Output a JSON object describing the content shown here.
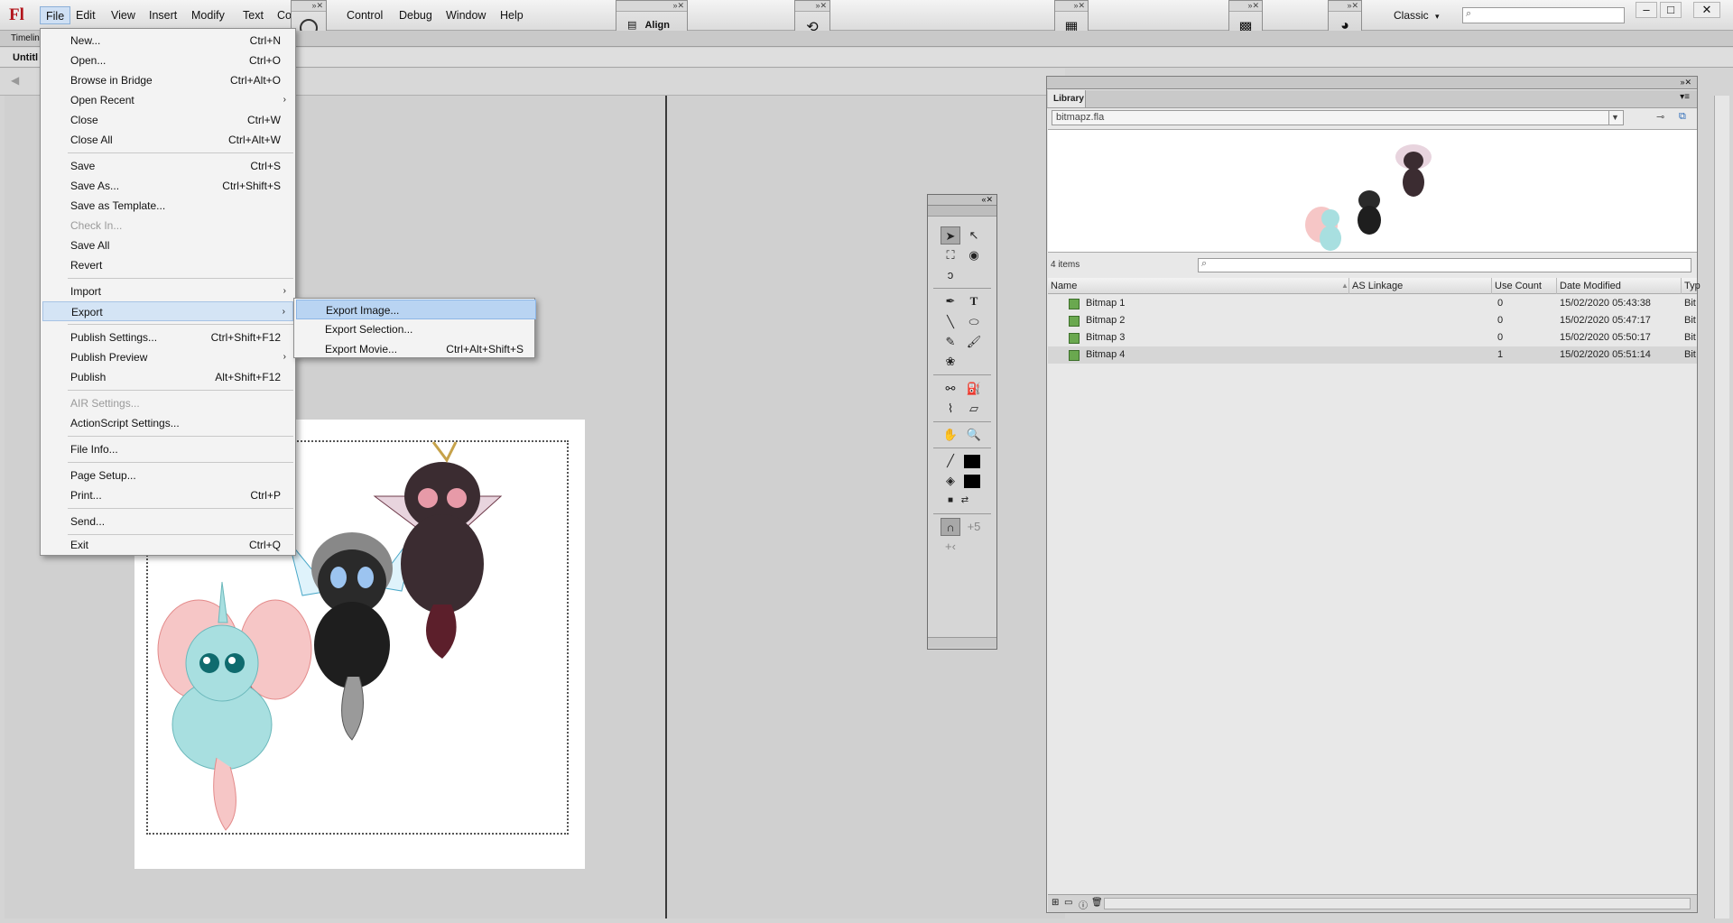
{
  "app": {
    "logo": "Fl",
    "menus": [
      "File",
      "Edit",
      "View",
      "Insert",
      "Modify",
      "Text",
      "Co",
      "Control",
      "Debug",
      "Window",
      "Help"
    ],
    "workspace": "Classic",
    "workspace_arrow": "▾",
    "float_panels": {
      "align_label": "Align"
    },
    "tab_timeline_partial": "Timelin",
    "doc_tab_partial": "Untitl"
  },
  "file_menu": {
    "items": [
      {
        "label": "New...",
        "shortcut": "Ctrl+N"
      },
      {
        "label": "Open...",
        "shortcut": "Ctrl+O"
      },
      {
        "label": "Browse in Bridge",
        "shortcut": "Ctrl+Alt+O"
      },
      {
        "label": "Open Recent",
        "shortcut": "",
        "submenu": true
      },
      {
        "label": "Close",
        "shortcut": "Ctrl+W"
      },
      {
        "label": "Close All",
        "shortcut": "Ctrl+Alt+W"
      },
      {
        "label": "Save",
        "shortcut": "Ctrl+S"
      },
      {
        "label": "Save As...",
        "shortcut": "Ctrl+Shift+S"
      },
      {
        "label": "Save as Template...",
        "shortcut": ""
      },
      {
        "label": "Check In...",
        "shortcut": "",
        "disabled": true
      },
      {
        "label": "Save All",
        "shortcut": ""
      },
      {
        "label": "Revert",
        "shortcut": ""
      },
      {
        "label": "Import",
        "shortcut": "",
        "submenu": true
      },
      {
        "label": "Export",
        "shortcut": "",
        "submenu": true
      },
      {
        "label": "Publish Settings...",
        "shortcut": "Ctrl+Shift+F12"
      },
      {
        "label": "Publish Preview",
        "shortcut": "",
        "submenu": true
      },
      {
        "label": "Publish",
        "shortcut": "Alt+Shift+F12"
      },
      {
        "label": "AIR Settings...",
        "shortcut": "",
        "disabled": true
      },
      {
        "label": "ActionScript Settings...",
        "shortcut": ""
      },
      {
        "label": "File Info...",
        "shortcut": ""
      },
      {
        "label": "Page Setup...",
        "shortcut": ""
      },
      {
        "label": "Print...",
        "shortcut": "Ctrl+P"
      },
      {
        "label": "Send...",
        "shortcut": ""
      },
      {
        "label": "Exit",
        "shortcut": "Ctrl+Q"
      }
    ],
    "submenu_arrow": "›"
  },
  "export_menu": {
    "items": [
      {
        "label": "Export Image...",
        "shortcut": ""
      },
      {
        "label": "Export Selection...",
        "shortcut": ""
      },
      {
        "label": "Export Movie...",
        "shortcut": "Ctrl+Alt+Shift+S"
      }
    ]
  },
  "library": {
    "tab": "Library",
    "file": "bitmapz.fla",
    "item_count": "4 items",
    "columns": {
      "name": "Name",
      "linkage": "AS Linkage",
      "use_count": "Use Count",
      "date": "Date Modified",
      "type": "Typ"
    },
    "rows": [
      {
        "name": "Bitmap 1",
        "use_count": "0",
        "date": "15/02/2020 05:43:38",
        "type": "Bit"
      },
      {
        "name": "Bitmap 2",
        "use_count": "0",
        "date": "15/02/2020 05:47:17",
        "type": "Bit"
      },
      {
        "name": "Bitmap 3",
        "use_count": "0",
        "date": "15/02/2020 05:50:17",
        "type": "Bit"
      },
      {
        "name": "Bitmap 4",
        "use_count": "1",
        "date": "15/02/2020 05:51:14",
        "type": "Bit"
      }
    ]
  },
  "tools": {
    "text_tool_glyph": "T"
  },
  "colors": {
    "menu_highlight": "#b9d4f2",
    "logo": "#b2141b",
    "character_cyan": "#a8dfe0",
    "character_black": "#2a2a2a",
    "character_maroon": "#3b2c31"
  }
}
